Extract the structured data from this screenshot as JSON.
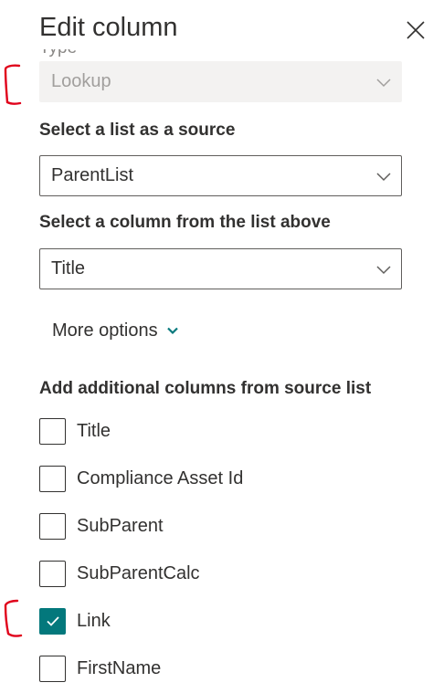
{
  "panel": {
    "title": "Edit column",
    "type_label": "Type"
  },
  "type_dropdown": {
    "value": "Lookup",
    "disabled": true
  },
  "source_list": {
    "label": "Select a list as a source",
    "value": "ParentList"
  },
  "source_column": {
    "label": "Select a column from the list above",
    "value": "Title"
  },
  "more_options": {
    "label": "More options"
  },
  "additional_columns": {
    "label": "Add additional columns from source list",
    "items": [
      {
        "label": "Title",
        "checked": false
      },
      {
        "label": "Compliance Asset Id",
        "checked": false
      },
      {
        "label": "SubParent",
        "checked": false
      },
      {
        "label": "SubParentCalc",
        "checked": false
      },
      {
        "label": "Link",
        "checked": true
      },
      {
        "label": "FirstName",
        "checked": false
      }
    ]
  },
  "colors": {
    "accent": "#03787c",
    "text": "#323130",
    "disabled_bg": "#f3f2f1",
    "annotation": "#e0001b"
  },
  "icons": {
    "close": "close-icon",
    "dropdown": "chevron-down-icon",
    "more_options": "chevron-down-icon",
    "checked": "checkmark-icon"
  }
}
